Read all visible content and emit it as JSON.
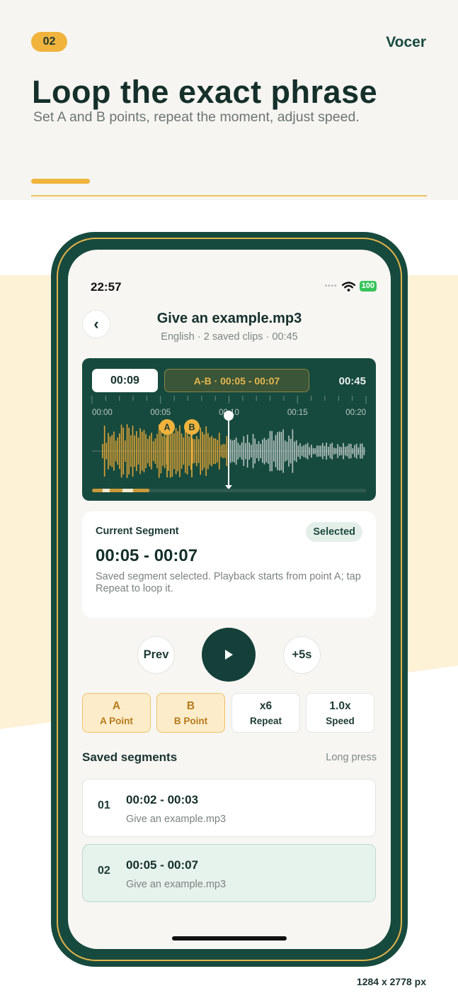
{
  "promo": {
    "step": "02",
    "brand": "Vocer",
    "headline": "Loop the exact phrase",
    "subline": "Set A and B points, repeat the moment, adjust speed.",
    "dimensions": "1284 x 2778 px"
  },
  "status": {
    "time": "22:57",
    "battery": "100"
  },
  "header": {
    "back_icon": "chevron-left-icon",
    "title": "Give an example.mp3",
    "meta": "English · 2 saved clips · 00:45"
  },
  "waveform": {
    "current_time": "00:09",
    "ab_range": "A-B · 00:05 - 00:07",
    "total_time": "00:45",
    "ticks": [
      "00:00",
      "00:05",
      "00:10",
      "00:15",
      "00:20"
    ],
    "marker_a": "A",
    "marker_b": "B",
    "playhead_fraction": 0.2,
    "progress_fraction": 0.21,
    "colors": {
      "played": "#e0a235",
      "unplayed": "#b9c7c3",
      "background": "#174a3e"
    }
  },
  "segment": {
    "label": "Current Segment",
    "badge": "Selected",
    "range": "00:05 - 00:07",
    "description": "Saved segment selected. Playback starts from point A; tap Repeat to loop it."
  },
  "controls": {
    "prev": "Prev",
    "play_icon": "play-icon",
    "forward": "+5s"
  },
  "tools": [
    {
      "value": "A",
      "label": "A Point"
    },
    {
      "value": "B",
      "label": "B Point"
    },
    {
      "value": "x6",
      "label": "Repeat"
    },
    {
      "value": "1.0x",
      "label": "Speed"
    }
  ],
  "saved": {
    "title": "Saved segments",
    "hint": "Long press",
    "items": [
      {
        "num": "01",
        "range": "00:02 - 00:03",
        "file": "Give an example.mp3"
      },
      {
        "num": "02",
        "range": "00:05 - 00:07",
        "file": "Give an example.mp3"
      }
    ]
  }
}
